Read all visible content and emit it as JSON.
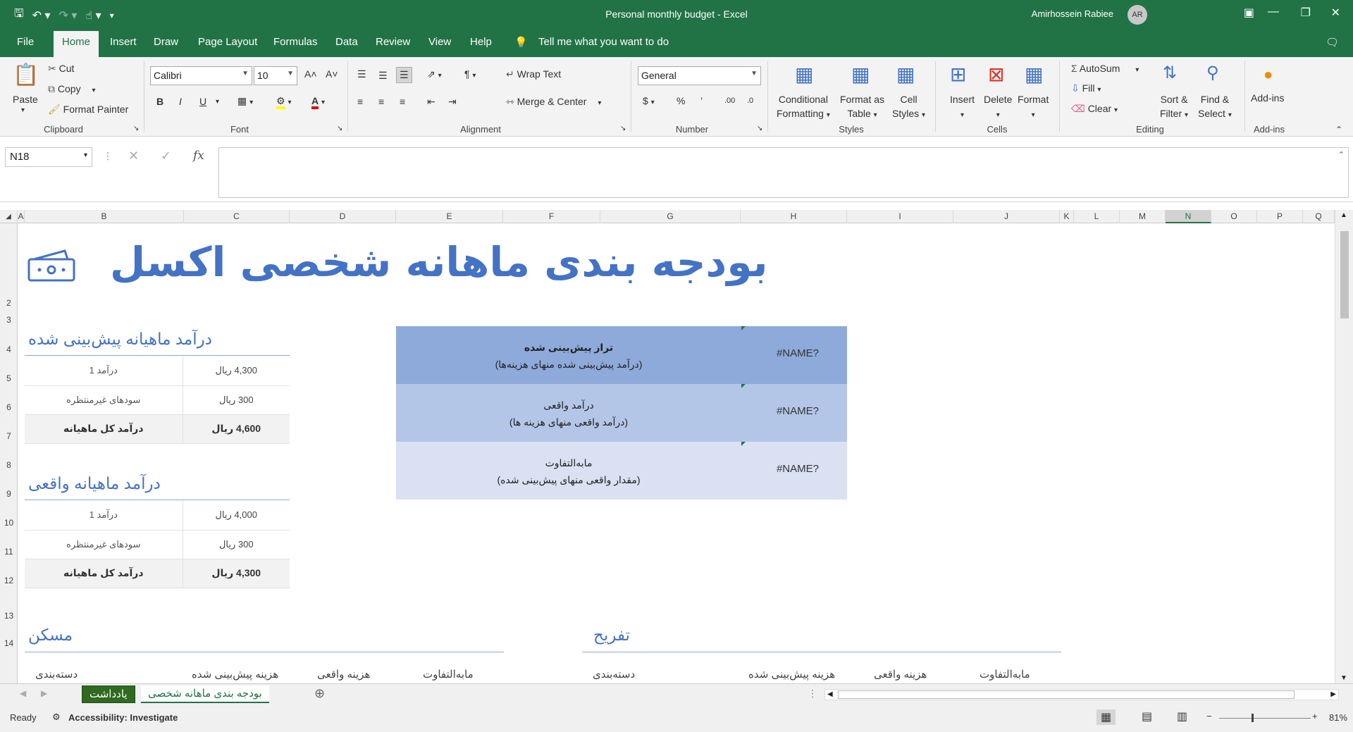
{
  "window": {
    "title": "Personal monthly budget  -  Excel",
    "user_name": "Amirhossein Rabiee",
    "user_initials": "AR"
  },
  "tabs": [
    "File",
    "Home",
    "Insert",
    "Draw",
    "Page Layout",
    "Formulas",
    "Data",
    "Review",
    "View",
    "Help"
  ],
  "tell_me": "Tell me what you want to do",
  "ribbon": {
    "clipboard": {
      "label": "Clipboard",
      "paste": "Paste",
      "cut": "Cut",
      "copy": "Copy",
      "format_painter": "Format Painter"
    },
    "font": {
      "label": "Font",
      "family": "Calibri",
      "size": "10"
    },
    "alignment": {
      "label": "Alignment",
      "wrap": "Wrap Text",
      "merge": "Merge & Center"
    },
    "number": {
      "label": "Number",
      "format": "General"
    },
    "styles": {
      "label": "Styles",
      "conditional": [
        "Conditional",
        "Formatting"
      ],
      "format_table": [
        "Format as",
        "Table"
      ],
      "cell_styles": [
        "Cell",
        "Styles"
      ]
    },
    "cells": {
      "label": "Cells",
      "insert": "Insert",
      "delete": "Delete",
      "format": "Format"
    },
    "editing": {
      "label": "Editing",
      "autosum": "AutoSum",
      "fill": "Fill",
      "clear": "Clear",
      "sort": [
        "Sort &",
        "Filter"
      ],
      "find": [
        "Find &",
        "Select"
      ]
    },
    "addins": {
      "label": "Add-ins",
      "button": "Add-ins"
    }
  },
  "formula_bar": {
    "name_box": "N18",
    "fx": "fx"
  },
  "columns": [
    "A",
    "B",
    "C",
    "D",
    "E",
    "F",
    "G",
    "H",
    "I",
    "J",
    "K",
    "L",
    "M",
    "N",
    "O",
    "P",
    "Q"
  ],
  "rows": [
    "2",
    "3",
    "4",
    "5",
    "6",
    "7",
    "8",
    "9",
    "10",
    "11",
    "12",
    "13",
    "14"
  ],
  "sheet": {
    "title": "بودجه بندی ماهانه شخصی اکسل",
    "projected": {
      "title": "درآمد ماهیانه پیش‌بینی شده",
      "rows": [
        {
          "label": "درآمد 1",
          "value": "4,300 ریال"
        },
        {
          "label": "سودهای غیرمنتظره",
          "value": "300 ریال"
        },
        {
          "label": "درآمد کل ماهیانه",
          "value": "4,600 ریال"
        }
      ]
    },
    "actual": {
      "title": "درآمد ماهیانه واقعی",
      "rows": [
        {
          "label": "درآمد 1",
          "value": "4,000 ریال"
        },
        {
          "label": "سودهای غیرمنتظره",
          "value": "300 ریال"
        },
        {
          "label": "درآمد کل ماهیانه",
          "value": "4,300 ریال"
        }
      ]
    },
    "summary": [
      {
        "line1": "تراز پیش‌بینی شده",
        "line2": "(درآمد پیش‌بینی شده منهای هزینه‌ها)",
        "value": "#NAME?",
        "color": "#8eaadb"
      },
      {
        "line1": "درآمد واقعی",
        "line2": "(درآمد واقعی منهای هزینه ها)",
        "value": "#NAME?",
        "color": "#b4c6e7"
      },
      {
        "line1": "مابه‌التفاوت",
        "line2": "(مقدار واقعی منهای پیش‌بینی شده)",
        "value": "#NAME?",
        "color": "#d9e1f2"
      }
    ],
    "housing": {
      "title": "مسکن",
      "cols": [
        "دسته‌بندی",
        "هزینه پیش‌بینی شده",
        "هزینه واقعی",
        "مابه‌التفاوت"
      ]
    },
    "entertainment": {
      "title": "تفریح",
      "cols": [
        "دسته‌بندی",
        "هزینه پیش‌بینی شده",
        "هزینه واقعی",
        "مابه‌التفاوت"
      ]
    }
  },
  "sheet_tabs": {
    "notes": "یادداشت",
    "budget": "بودجه بندی ماهانه شخصی"
  },
  "status": {
    "ready": "Ready",
    "accessibility": "Accessibility: Investigate",
    "zoom": "81%"
  },
  "colors": {
    "excel_green": "#217346",
    "accent_blue": "#4472c4"
  }
}
